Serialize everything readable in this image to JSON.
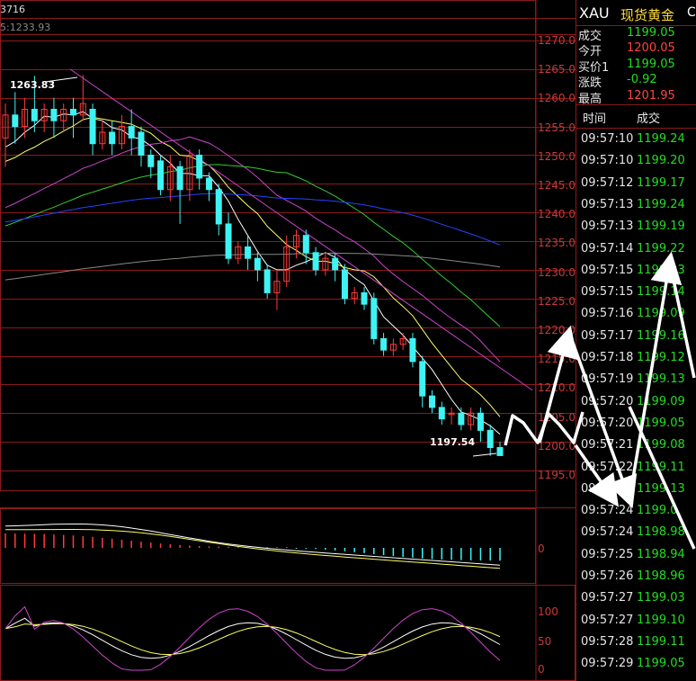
{
  "top_left": {
    "code_fragment": "3716",
    "ma_fragment": "5:1233.93"
  },
  "quote": {
    "symbol": "XAU",
    "name": "现货黄金",
    "right_clip": "C",
    "rows": [
      {
        "label": "成交",
        "value": "1199.05",
        "color": "#22dd22"
      },
      {
        "label": "今开",
        "value": "1200.05",
        "color": "#ff4444"
      },
      {
        "label": "买价1",
        "value": "1199.05",
        "color": "#22dd22"
      },
      {
        "label": "涨跌",
        "value": "-0.92",
        "color": "#22dd22"
      },
      {
        "label": "最高",
        "value": "1201.95",
        "color": "#ff4444"
      }
    ]
  },
  "ticks": {
    "header_time": "时间",
    "header_price": "成交",
    "rows": [
      {
        "time": "09:57:10",
        "price": "1199.24"
      },
      {
        "time": "09:57:10",
        "price": "1199.20"
      },
      {
        "time": "09:57:12",
        "price": "1199.17"
      },
      {
        "time": "09:57:13",
        "price": "1199.24"
      },
      {
        "time": "09:57:13",
        "price": "1199.19"
      },
      {
        "time": "09:57:14",
        "price": "1199.22"
      },
      {
        "time": "09:57:15",
        "price": "1199.23"
      },
      {
        "time": "09:57:15",
        "price": "1199.14"
      },
      {
        "time": "09:57:16",
        "price": "1199.09"
      },
      {
        "time": "09:57:17",
        "price": "1199.16"
      },
      {
        "time": "09:57:18",
        "price": "1199.12"
      },
      {
        "time": "09:57:19",
        "price": "1199.13"
      },
      {
        "time": "09:57:20",
        "price": "1199.09"
      },
      {
        "time": "09:57:20",
        "price": "1199.05"
      },
      {
        "time": "09:57:21",
        "price": "1199.08"
      },
      {
        "time": "09:57:22",
        "price": "1199.11"
      },
      {
        "time": "09:57:23",
        "price": "1199.13"
      },
      {
        "time": "09:57:24",
        "price": "1199.0"
      },
      {
        "time": "09:57:24",
        "price": "1198.98"
      },
      {
        "time": "09:57:25",
        "price": "1198.94"
      },
      {
        "time": "09:57:26",
        "price": "1198.96"
      },
      {
        "time": "09:57:27",
        "price": "1199.03"
      },
      {
        "time": "09:57:27",
        "price": "1199.10"
      },
      {
        "time": "09:57:28",
        "price": "1199.11"
      },
      {
        "time": "09:57:29",
        "price": "1199.05"
      }
    ]
  },
  "main_axis": [
    "1270.0",
    "1265.0",
    "1260.0",
    "1255.0",
    "1250.0",
    "1245.0",
    "1240.0",
    "1235.0",
    "1230.0",
    "1225.0",
    "1220.0",
    "1215.0",
    "1210.0",
    "1205.0",
    "1200.0",
    "1195.0"
  ],
  "high_label": "1263.83",
  "low_label": "1197.54",
  "macd_axis": "0",
  "kdj_axis": [
    "100",
    "50",
    "0"
  ],
  "colors": {
    "up": "#ff3b3b",
    "down": "#3ef3f3",
    "ma5": "#ffffff",
    "ma10": "#ffff66",
    "ma20": "#cc44cc",
    "ma30": "#33cc33",
    "ma60": "#2244ff",
    "ma120": "#888888",
    "grid": "#8a1a1a",
    "annotation": "#ffffff"
  },
  "candles": [
    {
      "o": 1253,
      "c": 1257,
      "h": 1259,
      "l": 1248
    },
    {
      "o": 1257,
      "c": 1255,
      "h": 1261,
      "l": 1252
    },
    {
      "o": 1255,
      "c": 1258,
      "h": 1260,
      "l": 1253
    },
    {
      "o": 1258,
      "c": 1256,
      "h": 1263.83,
      "l": 1254
    },
    {
      "o": 1256,
      "c": 1258,
      "h": 1259,
      "l": 1254
    },
    {
      "o": 1258,
      "c": 1256,
      "h": 1260,
      "l": 1253
    },
    {
      "o": 1256,
      "c": 1258,
      "h": 1259,
      "l": 1254
    },
    {
      "o": 1258,
      "c": 1257,
      "h": 1260,
      "l": 1253
    },
    {
      "o": 1257,
      "c": 1259,
      "h": 1264,
      "l": 1256
    },
    {
      "o": 1258,
      "c": 1252,
      "h": 1259,
      "l": 1250
    },
    {
      "o": 1252,
      "c": 1254,
      "h": 1256,
      "l": 1251
    },
    {
      "o": 1254,
      "c": 1252,
      "h": 1256,
      "l": 1250
    },
    {
      "o": 1252,
      "c": 1255,
      "h": 1257,
      "l": 1251
    },
    {
      "o": 1255,
      "c": 1253,
      "h": 1258,
      "l": 1250
    },
    {
      "o": 1254,
      "c": 1250,
      "h": 1255,
      "l": 1248
    },
    {
      "o": 1250,
      "c": 1248,
      "h": 1251,
      "l": 1246
    },
    {
      "o": 1249,
      "c": 1244,
      "h": 1250,
      "l": 1243
    },
    {
      "o": 1244,
      "c": 1248,
      "h": 1250,
      "l": 1242
    },
    {
      "o": 1248,
      "c": 1244,
      "h": 1249,
      "l": 1238
    },
    {
      "o": 1244,
      "c": 1250,
      "h": 1251,
      "l": 1242
    },
    {
      "o": 1250,
      "c": 1246,
      "h": 1251,
      "l": 1244
    },
    {
      "o": 1246,
      "c": 1244,
      "h": 1247,
      "l": 1242
    },
    {
      "o": 1244,
      "c": 1238,
      "h": 1245,
      "l": 1236
    },
    {
      "o": 1238,
      "c": 1232,
      "h": 1240,
      "l": 1231
    },
    {
      "o": 1232,
      "c": 1234,
      "h": 1235,
      "l": 1231
    },
    {
      "o": 1234,
      "c": 1232,
      "h": 1236,
      "l": 1230
    },
    {
      "o": 1232,
      "c": 1230,
      "h": 1233,
      "l": 1228
    },
    {
      "o": 1230,
      "c": 1226,
      "h": 1231,
      "l": 1225
    },
    {
      "o": 1226,
      "c": 1228,
      "h": 1230,
      "l": 1223
    },
    {
      "o": 1228,
      "c": 1234,
      "h": 1236,
      "l": 1227
    },
    {
      "o": 1234,
      "c": 1236,
      "h": 1237,
      "l": 1232
    },
    {
      "o": 1236,
      "c": 1233,
      "h": 1237,
      "l": 1231
    },
    {
      "o": 1233,
      "c": 1230,
      "h": 1234,
      "l": 1229
    },
    {
      "o": 1230,
      "c": 1232,
      "h": 1233,
      "l": 1229
    },
    {
      "o": 1232,
      "c": 1230,
      "h": 1233,
      "l": 1228
    },
    {
      "o": 1230,
      "c": 1225,
      "h": 1231,
      "l": 1224
    },
    {
      "o": 1225,
      "c": 1226,
      "h": 1227,
      "l": 1224
    },
    {
      "o": 1226,
      "c": 1224,
      "h": 1227,
      "l": 1223
    },
    {
      "o": 1225,
      "c": 1218,
      "h": 1226,
      "l": 1217
    },
    {
      "o": 1218,
      "c": 1216,
      "h": 1219,
      "l": 1215
    },
    {
      "o": 1216,
      "c": 1217,
      "h": 1218,
      "l": 1215
    },
    {
      "o": 1217,
      "c": 1218,
      "h": 1219,
      "l": 1216
    },
    {
      "o": 1218,
      "c": 1214,
      "h": 1219,
      "l": 1213
    },
    {
      "o": 1214,
      "c": 1208,
      "h": 1215,
      "l": 1206
    },
    {
      "o": 1208,
      "c": 1206,
      "h": 1209,
      "l": 1205
    },
    {
      "o": 1206,
      "c": 1204,
      "h": 1207,
      "l": 1203
    },
    {
      "o": 1205,
      "c": 1205,
      "h": 1206,
      "l": 1203
    },
    {
      "o": 1205,
      "c": 1203,
      "h": 1206,
      "l": 1202
    },
    {
      "o": 1203,
      "c": 1205,
      "h": 1206,
      "l": 1202
    },
    {
      "o": 1205,
      "c": 1202,
      "h": 1206,
      "l": 1200
    },
    {
      "o": 1202,
      "c": 1199,
      "h": 1203,
      "l": 1197.54
    },
    {
      "o": 1199,
      "c": 1197.6,
      "h": 1200,
      "l": 1197.54
    }
  ]
}
